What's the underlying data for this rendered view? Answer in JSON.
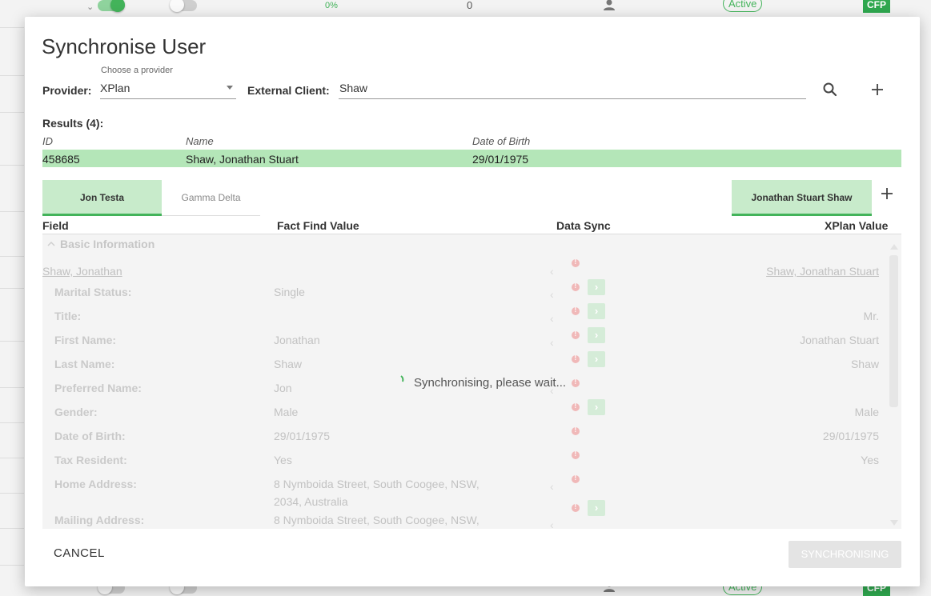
{
  "background": {
    "progress_text": "0%",
    "count": "0",
    "status_badge": "Active",
    "cfp_badge": "CFP"
  },
  "modal": {
    "title": "Synchronise User",
    "provider": {
      "label": "Provider:",
      "hint": "Choose a provider",
      "value": "XPlan"
    },
    "external_client": {
      "label": "External Client:",
      "value": "Shaw"
    },
    "results": {
      "label": "Results (4):",
      "columns": [
        "ID",
        "Name",
        "Date of Birth"
      ],
      "selected_row": {
        "id": "458685",
        "name": "Shaw, Jonathan Stuart",
        "dob": "29/01/1975"
      }
    },
    "tabs": {
      "left": [
        "Jon Testa",
        "Gamma Delta"
      ],
      "right": [
        "Jonathan Stuart Shaw"
      ]
    },
    "table": {
      "headers": [
        "Field",
        "Fact Find Value",
        "Data Sync",
        "XPlan Value"
      ],
      "section": "Basic Information",
      "person_link_left": "Shaw, Jonathan",
      "person_link_right": "Shaw, Jonathan Stuart",
      "rows": [
        {
          "field": "Marital Status:",
          "ff": "Single",
          "xplan": ""
        },
        {
          "field": "Title:",
          "ff": "",
          "xplan": "Mr."
        },
        {
          "field": "First Name:",
          "ff": "Jonathan",
          "xplan": "Jonathan Stuart"
        },
        {
          "field": "Last Name:",
          "ff": "Shaw",
          "xplan": "Shaw"
        },
        {
          "field": "Preferred Name:",
          "ff": "Jon",
          "xplan": ""
        },
        {
          "field": "Gender:",
          "ff": "Male",
          "xplan": "Male"
        },
        {
          "field": "Date of Birth:",
          "ff": "29/01/1975",
          "xplan": "29/01/1975"
        },
        {
          "field": "Tax Resident:",
          "ff": "Yes",
          "xplan": "Yes"
        },
        {
          "field": "Home Address:",
          "ff": "8 Nymboida Street, South Coogee, NSW,",
          "ff2": "2034, Australia",
          "xplan": ""
        },
        {
          "field": "Mailing Address:",
          "ff": "8 Nymboida Street, South Coogee, NSW,",
          "xplan": ""
        }
      ]
    },
    "overlay_message": "Synchronising, please wait...",
    "cancel_label": "CANCEL",
    "sync_label": "SYNCHRONISING"
  },
  "icons": [
    "search-icon",
    "plus-icon",
    "chevron-left-icon",
    "chevron-right-icon",
    "alert-dot-icon",
    "chevron-up-icon"
  ],
  "colors": {
    "accent": "#43b35a",
    "selected_row": "#b4e6b8",
    "alert": "#f0b8b8"
  }
}
